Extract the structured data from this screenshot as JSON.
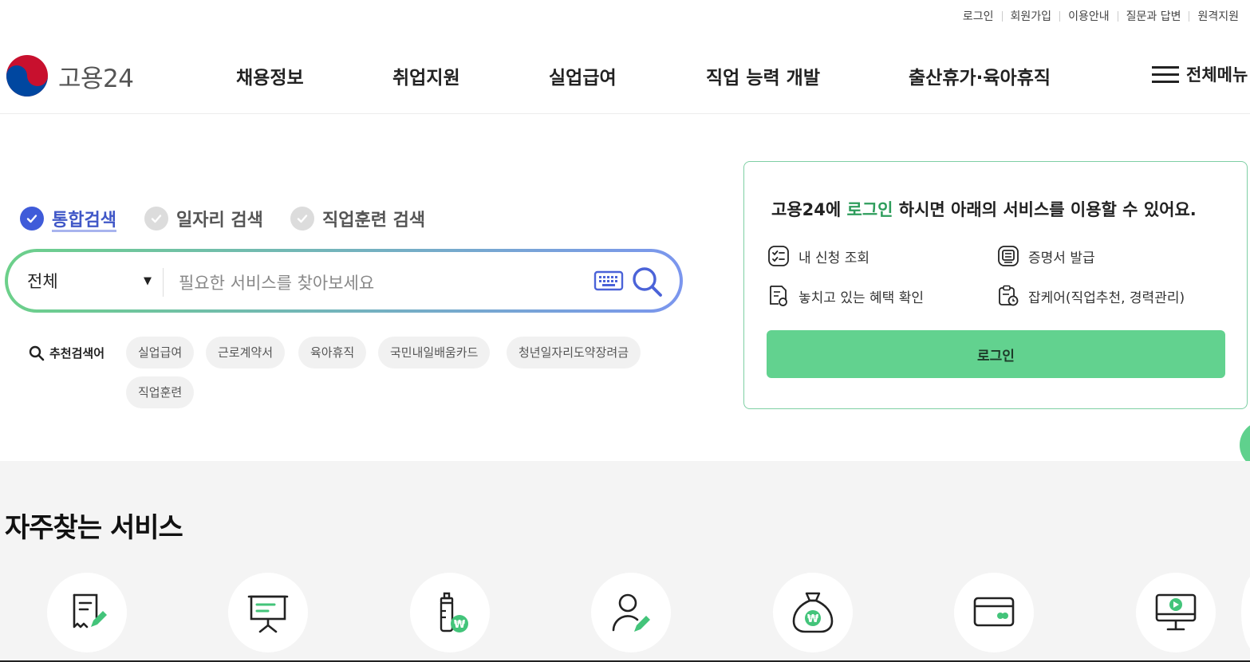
{
  "utility_links": [
    "로그인",
    "회원가입",
    "이용안내",
    "질문과 답변",
    "원격지원"
  ],
  "brand": {
    "name": "고용24"
  },
  "nav": [
    "채용정보",
    "취업지원",
    "실업급여",
    "직업 능력 개발",
    "출산휴가·육아휴직"
  ],
  "all_menu_label": "전체메뉴",
  "search_tabs": [
    {
      "label": "통합검색",
      "active": true
    },
    {
      "label": "일자리 검색",
      "active": false
    },
    {
      "label": "직업훈련 검색",
      "active": false
    }
  ],
  "search": {
    "scope": "전체",
    "placeholder": "필요한 서비스를 찾아보세요"
  },
  "recommended": {
    "label": "추천검색어",
    "keywords": [
      "실업급여",
      "근로계약서",
      "육아휴직",
      "국민내일배움카드",
      "청년일자리도약장려금",
      "직업훈련"
    ]
  },
  "login_panel": {
    "title_before": "고용24에 ",
    "title_highlight": "로그인",
    "title_after": " 하시면 아래의 서비스를 이용할 수 있어요.",
    "services": [
      "내 신청 조회",
      "증명서 발급",
      "놓치고 있는 혜택 확인",
      "잡케어(직업추천, 경력관리)"
    ],
    "button": "로그인"
  },
  "frequent": {
    "title": "자주찾는 서비스",
    "icons": [
      "document-edit-icon",
      "presentation-icon",
      "baby-bottle-won-icon",
      "user-edit-icon",
      "money-bag-icon",
      "card-icon",
      "monitor-play-icon"
    ]
  },
  "colors": {
    "accent_green": "#62d28f",
    "accent_blue": "#3f5bd9",
    "highlight_text": "#2e9d5c"
  }
}
